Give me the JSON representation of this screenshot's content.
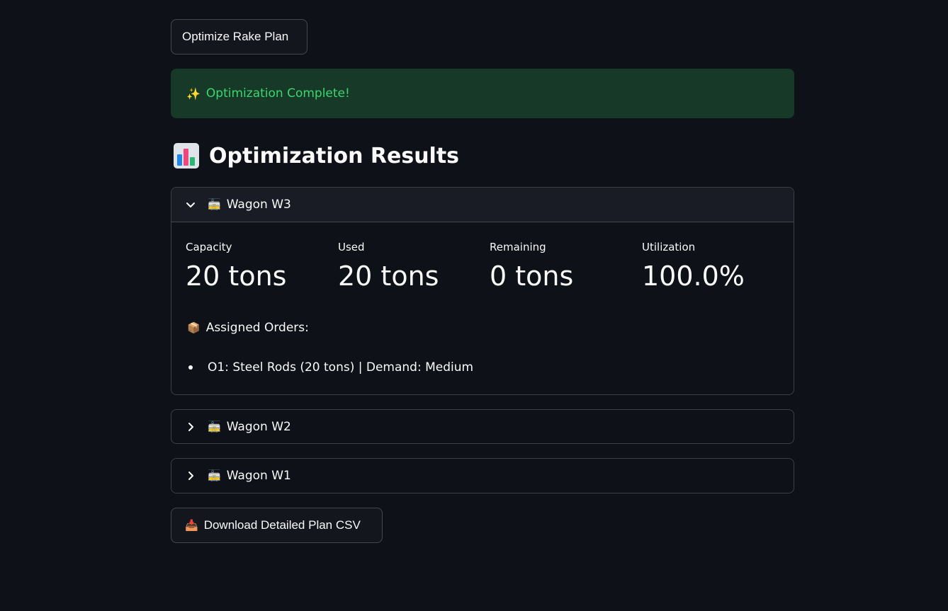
{
  "actions": {
    "optimize_label": "Optimize Rake Plan",
    "download_label": "Download Detailed Plan CSV",
    "download_icon": "📥"
  },
  "alert": {
    "icon": "✨",
    "text": "Optimization Complete!"
  },
  "results": {
    "title": "Optimization Results"
  },
  "wagons": [
    {
      "icon": "🚋",
      "title": "Wagon W3",
      "expanded": true,
      "metrics": [
        {
          "label": "Capacity",
          "value": "20 tons"
        },
        {
          "label": "Used",
          "value": "20 tons"
        },
        {
          "label": "Remaining",
          "value": "0 tons"
        },
        {
          "label": "Utilization",
          "value": "100.0%"
        }
      ],
      "assigned_icon": "📦",
      "assigned_label": "Assigned Orders:",
      "orders": [
        "O1: Steel Rods (20 tons) | Demand: Medium"
      ]
    },
    {
      "icon": "🚋",
      "title": "Wagon W2",
      "expanded": false
    },
    {
      "icon": "🚋",
      "title": "Wagon W1",
      "expanded": false
    }
  ],
  "colors": {
    "background": "#0e1117",
    "alert_bg": "#173928",
    "alert_text": "#3dd56d"
  }
}
